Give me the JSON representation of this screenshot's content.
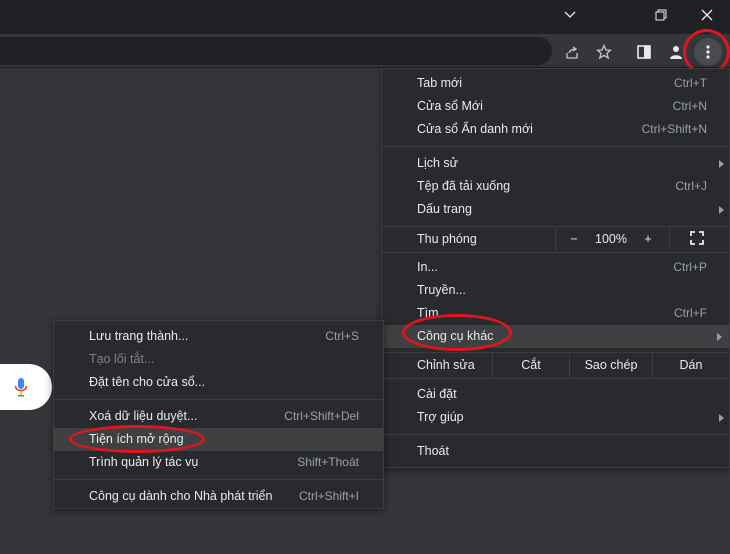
{
  "window": {
    "controls": [
      "minimize-icon",
      "restore-icon",
      "close-icon"
    ]
  },
  "toolbar": {
    "icons": [
      "share-icon",
      "star-icon",
      "side-panel-icon",
      "profile-icon",
      "more-vert-icon"
    ]
  },
  "main_menu": {
    "items": [
      {
        "label": "Tab mới",
        "shortcut": "Ctrl+T"
      },
      {
        "label": "Cửa sổ Mới",
        "shortcut": "Ctrl+N"
      },
      {
        "label": "Cửa sổ Ẩn danh mới",
        "shortcut": "Ctrl+Shift+N"
      },
      {
        "label": "Lịch sử",
        "shortcut": ""
      },
      {
        "label": "Tệp đã tải xuống",
        "shortcut": "Ctrl+J"
      },
      {
        "label": "Dấu trang",
        "shortcut": ""
      },
      {
        "label": "In...",
        "shortcut": "Ctrl+P"
      },
      {
        "label": "Truyền...",
        "shortcut": ""
      },
      {
        "label": "Tìm...",
        "shortcut": "Ctrl+F"
      },
      {
        "label": "Công cụ khác",
        "shortcut": ""
      },
      {
        "label": "Cài đặt",
        "shortcut": ""
      },
      {
        "label": "Trợ giúp",
        "shortcut": ""
      },
      {
        "label": "Thoát",
        "shortcut": ""
      }
    ],
    "zoom": {
      "label": "Thu phóng",
      "minus": "−",
      "value": "100%",
      "plus": "+"
    },
    "edit": {
      "label": "Chỉnh sửa",
      "cut": "Cắt",
      "copy": "Sao chép",
      "paste": "Dán"
    }
  },
  "submenu": {
    "items": [
      {
        "label": "Lưu trang thành...",
        "shortcut": "Ctrl+S"
      },
      {
        "label": "Tạo lối tắt...",
        "shortcut": ""
      },
      {
        "label": "Đặt tên cho cửa sổ...",
        "shortcut": ""
      },
      {
        "label": "Xoá dữ liệu duyệt...",
        "shortcut": "Ctrl+Shift+Del"
      },
      {
        "label": "Tiện ích mở rộng",
        "shortcut": ""
      },
      {
        "label": "Trình quản lý tác vụ",
        "shortcut": "Shift+Thoát"
      },
      {
        "label": "Công cụ dành cho Nhà phát triển",
        "shortcut": "Ctrl+Shift+I"
      }
    ]
  },
  "colors": {
    "menu_bg": "#292a2d",
    "page_bg": "#35363a",
    "titlebar": "#202124",
    "highlight_ring": "#e0161f"
  }
}
